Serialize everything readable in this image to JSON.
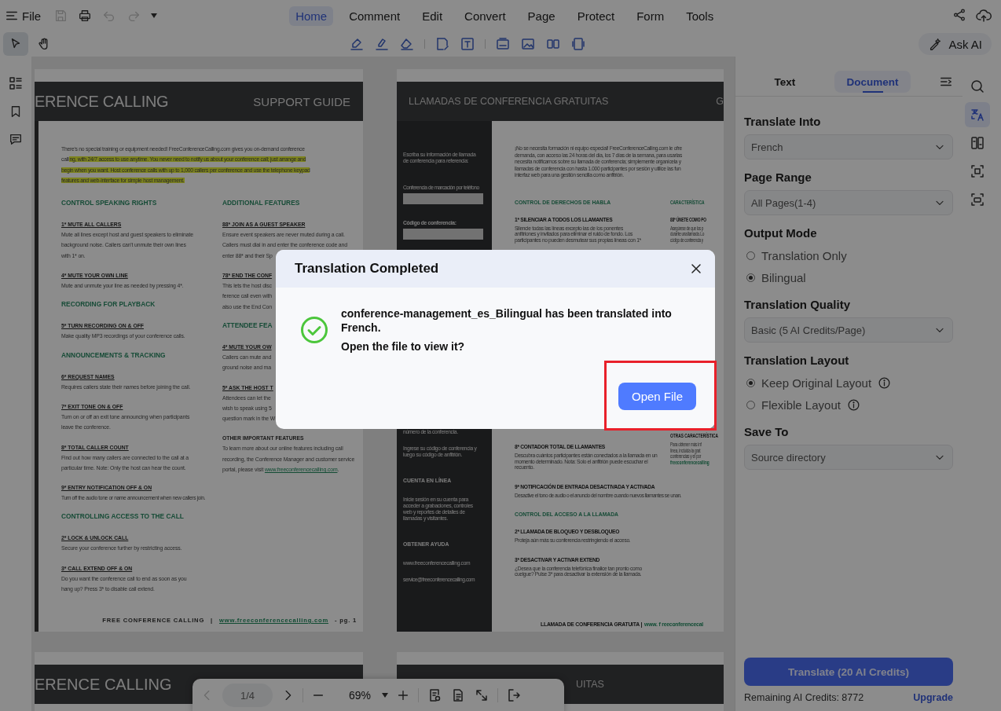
{
  "menu_bar": {
    "file_label": "File",
    "quick_actions": [
      {
        "disabled": true
      },
      {
        "disabled": false
      },
      {
        "disabled": true
      },
      {
        "disabled": true
      }
    ],
    "tabs": [
      {
        "label": "Home",
        "selected": true
      },
      {
        "label": "Comment",
        "selected": false
      },
      {
        "label": "Edit",
        "selected": false
      },
      {
        "label": "Convert",
        "selected": false
      },
      {
        "label": "Page",
        "selected": false
      },
      {
        "label": "Protect",
        "selected": false
      },
      {
        "label": "Form",
        "selected": false
      },
      {
        "label": "Tools",
        "selected": false
      }
    ]
  },
  "toolbar": {
    "tools": [
      {
        "selected": true
      },
      {
        "selected": false
      }
    ],
    "ask_ai_label": "Ask AI"
  },
  "page_1": {
    "header_left": "ERENCE CALLING",
    "header_right": "SUPPORT GUIDE",
    "intro": [
      [
        {
          "text": "There's no special training or equipment needed! FreeConferenceCalling.com gives you on-demand conference",
          "highlight": false
        }
      ],
      [
        {
          "text": "calli",
          "highlight": false
        },
        {
          "text": "ng, with 24/7 access to use anytime. You never need to notify us about your conference call; just arrange and",
          "highlight": true
        }
      ],
      [
        {
          "text": "begin when you want. Host conference calls with up to 1,000 callers per conference and use the telephone keypad",
          "highlight": true
        }
      ],
      [
        {
          "text": "features and web-interface for simple host management.",
          "highlight": true
        }
      ]
    ],
    "left": [
      {
        "kind": "heading",
        "text": "CONTROL SPEAKING RIGHTS"
      },
      {
        "kind": "item",
        "text": "1* MUTE ALL CALLERS"
      },
      {
        "kind": "text",
        "lines": [
          "Mute all lines except host and guest speakers to eliminate",
          "background noise. Callers can't unmute their own lines",
          "with 1* on."
        ]
      },
      {
        "kind": "item",
        "text": "4* MUTE YOUR OWN LINE"
      },
      {
        "kind": "text",
        "lines": [
          "Mute and unmute your line as needed by pressing 4*."
        ]
      },
      {
        "kind": "heading",
        "text": "RECORDING FOR PLAYBACK"
      },
      {
        "kind": "item",
        "text": "5* TURN RECORDING ON & OFF"
      },
      {
        "kind": "text",
        "lines": [
          "Make quality MP3 recordings of your conference calls."
        ]
      },
      {
        "kind": "heading",
        "text": "ANNOUNCEMENTS & TRACKING"
      },
      {
        "kind": "item",
        "text": "6* REQUEST NAMES"
      },
      {
        "kind": "text",
        "lines": [
          "Requires callers state their names before joining the call."
        ]
      },
      {
        "kind": "item",
        "text": "7* EXIT TONE ON & OFF"
      },
      {
        "kind": "text",
        "lines": [
          "Turn on or off an exit tone announcing when participants",
          "leave the conference."
        ]
      },
      {
        "kind": "item",
        "text": "8* TOTAL CALLER COUNT"
      },
      {
        "kind": "text",
        "lines": [
          "Find out how many callers are connected to the call at a",
          "particular time. Note: Only the host can hear the count."
        ]
      },
      {
        "kind": "item",
        "text": "9* ENTRY NOTIFICATION OFF & ON"
      },
      {
        "kind": "tiny",
        "lines": [
          "Turn off the audio tone or name announcement when new callers join."
        ]
      },
      {
        "kind": "heading",
        "text": "CONTROLLING ACCESS TO THE CALL"
      },
      {
        "kind": "item",
        "text": "2* LOCK & UNLOCK CALL"
      },
      {
        "kind": "text",
        "lines": [
          "Secure your conference further by restricting access."
        ]
      },
      {
        "kind": "item",
        "text": "3* CALL EXTEND OFF & ON"
      },
      {
        "kind": "text",
        "lines": [
          "Do you want the conference call to end as soon as you",
          "hang up?  Press 3* to disable call extend."
        ]
      }
    ],
    "right": [
      {
        "kind": "heading",
        "text": "ADDITIONAL FEATURES"
      },
      {
        "kind": "item",
        "text": "88* JOIN AS A GUEST SPEAKER"
      },
      {
        "kind": "text",
        "lines": [
          "Ensure event speakers are never muted during a call.",
          "Callers must dial in and enter the conference code and",
          "enter 88* and their Sp"
        ]
      },
      {
        "kind": "item",
        "text": "78* END THE CONF"
      },
      {
        "kind": "text",
        "lines": [
          "This lets the host disc",
          "ference call even with",
          "also use the End Con"
        ]
      },
      {
        "kind": "heading",
        "text": "ATTENDEE FEA"
      },
      {
        "kind": "item",
        "text": "4* MUTE YOUR OW"
      },
      {
        "kind": "text",
        "lines": [
          "Callers can mute and",
          "ground noise and ma"
        ]
      },
      {
        "kind": "item",
        "text": "5* ASK THE HOST T"
      },
      {
        "kind": "text",
        "lines": [
          "Attendees can let the",
          "wish to speak using 5",
          "question mark in the W"
        ]
      },
      {
        "kind": "subheading",
        "text": "OTHER IMPORTANT FEATURES"
      },
      {
        "kind": "text",
        "lines": [
          "To learn more about our online features including call",
          "recording, the Conference Manager and customer service",
          "portal, please visit"
        ],
        "link": "www.freeconferencecalling.com",
        "after": "."
      }
    ],
    "footer": {
      "title": "FREE CONFERENCE CALLING",
      "separator": "|",
      "link": "www.freeconferencecalling.com",
      "page": "- pg. 1"
    }
  },
  "page_2": {
    "header": "LLAMADAS DE CONFERENCIA GRATUITAS",
    "header_right": "G",
    "sidebar_upper": [
      {
        "kind": "text",
        "lines": [
          "Escriba su información de llamada",
          "de conferencia para referencia:"
        ]
      },
      {
        "kind": "label",
        "text": "Conferencia de marcación por teléfono"
      },
      {
        "kind": "field"
      },
      {
        "kind": "label_bold",
        "text": "Código de conferencia:"
      },
      {
        "kind": "field"
      }
    ],
    "sidebar_lower": [
      {
        "kind": "text",
        "lines": [
          "número de la conferencia."
        ]
      },
      {
        "kind": "text",
        "lines": [
          "Ingrese su código de conferencia y",
          "luego su código de anfitrión."
        ]
      },
      {
        "kind": "subheading",
        "text": "CUENTA EN LÍNEA"
      },
      {
        "kind": "text",
        "lines": [
          "Inicie sesión en su cuenta para",
          "acceder a grabaciones, controles",
          "web y reportes de detalles de",
          "llamadas y visitantes."
        ]
      },
      {
        "kind": "subheading",
        "text": "OBTENER AYUDA"
      },
      {
        "kind": "text",
        "lines": [
          "www.freeconferencecalling.com"
        ]
      },
      {
        "kind": "tiny",
        "lines": [
          "service@freeconferencecalling.com"
        ]
      }
    ],
    "intro": [
      "¡No se necesita formación ni equipo especial! FreeConferenceCalling.com le ofre",
      "demanda, con acceso las 24 horas del día, los 7 días de la semana, para usarlas",
      "necesita notificarnos sobre su llamada de conferencia; simplemente organícela y",
      "llamadas de conferencia con hasta 1.000 participantes por sesión y utilice las fun",
      "interfaz web para una gestión sencilla como anfitrión."
    ],
    "upper_left": [
      {
        "kind": "heading",
        "text": "CONTROL DE DERECHOS DE HABLA"
      },
      {
        "kind": "item",
        "text": "1* SILENCIAR A TODOS LOS LLAMANTES"
      },
      {
        "kind": "text",
        "lines": [
          "Silencie todas las líneas excepto las de los ponentes",
          "anfitriones y invitados para eliminar el ruido de fondo. Los",
          "participantes no pueden desmutear sus propias líneas con 1*"
        ]
      }
    ],
    "upper_right": [
      {
        "kind": "heading",
        "text": "CARACTERÍSTICA"
      },
      {
        "kind": "item",
        "text": "88* ÚNETE COMO PO"
      },
      {
        "kind": "tiny",
        "lines": [
          "Asegúrese de que los p",
          "durante una llamada. Lo",
          "código de conferencia y"
        ]
      }
    ],
    "lower_left": [
      {
        "kind": "item",
        "text": "8* CONTADOR TOTAL DE LLAMANTES"
      },
      {
        "kind": "text",
        "lines": [
          "Descubra cuántos participantes están conectados a la llamada en un",
          "momento determinado. Nota: Solo el anfitrión puede escuchar el",
          "recuento."
        ]
      },
      {
        "kind": "item",
        "text": "9* NOTIFICACIÓN DE ENTRADA DESACTIVADA Y ACTIVADA"
      },
      {
        "kind": "tiny",
        "lines": [
          "Desactive el tono de audio o el anuncio del nombre cuando nuevos llamantes se unan."
        ]
      },
      {
        "kind": "heading",
        "text": "CONTROL DEL ACCESO A LA LLAMADA"
      },
      {
        "kind": "item",
        "text": "2* LLAMADA DE BLOQUEO Y DESBLOQUEO"
      },
      {
        "kind": "text",
        "lines": [
          "Proteja aún más su conferencia restringiendo el acceso."
        ]
      },
      {
        "kind": "item",
        "text": "3* DESACTIVAR Y ACTIVAR EXTEND"
      },
      {
        "kind": "text",
        "lines": [
          "¿Desea que la conferencia telefónica finalice tan pronto como",
          "cuelgue? Pulse 3* para desactivar la extensión de la llamada."
        ]
      }
    ],
    "lower_right": [
      {
        "kind": "subheading",
        "text": "OTRAS CARACTERÍSTICA"
      },
      {
        "kind": "text",
        "lines": [
          "Para obtener más inf",
          "línea, incluida la grat",
          "conferencias y el por"
        ]
      },
      {
        "kind": "link",
        "text": "freeconferencecalling"
      }
    ],
    "footer": {
      "title": "LLAMADA DE CONFERENCIA GRATUITA |",
      "link": "www. f reeconferencecal"
    }
  },
  "page_3": {
    "header": "ERENCE CALLING"
  },
  "page_4": {
    "header": "UITAS"
  },
  "pager": {
    "prev_disabled": true,
    "page": "1/4",
    "zoom": "69%"
  },
  "side_panel": {
    "tabs": [
      {
        "label": "Text",
        "selected": false
      },
      {
        "label": "Document",
        "selected": true
      }
    ],
    "fields": [
      {
        "kind": "select",
        "label": "Translate Into",
        "value": "French"
      },
      {
        "kind": "select",
        "label": "Page Range",
        "value": "All Pages(1-4)"
      },
      {
        "kind": "radio",
        "label": "Output Mode",
        "options": [
          {
            "label": "Translation Only",
            "selected": false,
            "info": false
          },
          {
            "label": "Bilingual",
            "selected": true,
            "info": false
          }
        ]
      },
      {
        "kind": "select",
        "label": "Translation Quality",
        "value": "Basic (5 AI Credits/Page)"
      },
      {
        "kind": "radio",
        "label": "Translation Layout",
        "options": [
          {
            "label": "Keep Original Layout",
            "selected": true,
            "info": true
          },
          {
            "label": "Flexible Layout",
            "selected": false,
            "info": true
          }
        ]
      },
      {
        "kind": "select",
        "label": "Save To",
        "value": "Source directory"
      }
    ],
    "translate_button": "Translate (20 AI Credits)",
    "credits": "Remaining AI Credits: 8772",
    "upgrade_link": "Upgrade"
  },
  "side_rail": [
    {
      "selected": false
    },
    {
      "selected": true
    },
    {
      "selected": false
    },
    {
      "selected": false
    },
    {
      "selected": false
    }
  ],
  "dialog": {
    "title": "Translation Completed",
    "message": "conference-management_es_Bilingual has been translated into French.",
    "question": "Open the file to view it?",
    "button": "Open File",
    "button_highlighted": true
  }
}
